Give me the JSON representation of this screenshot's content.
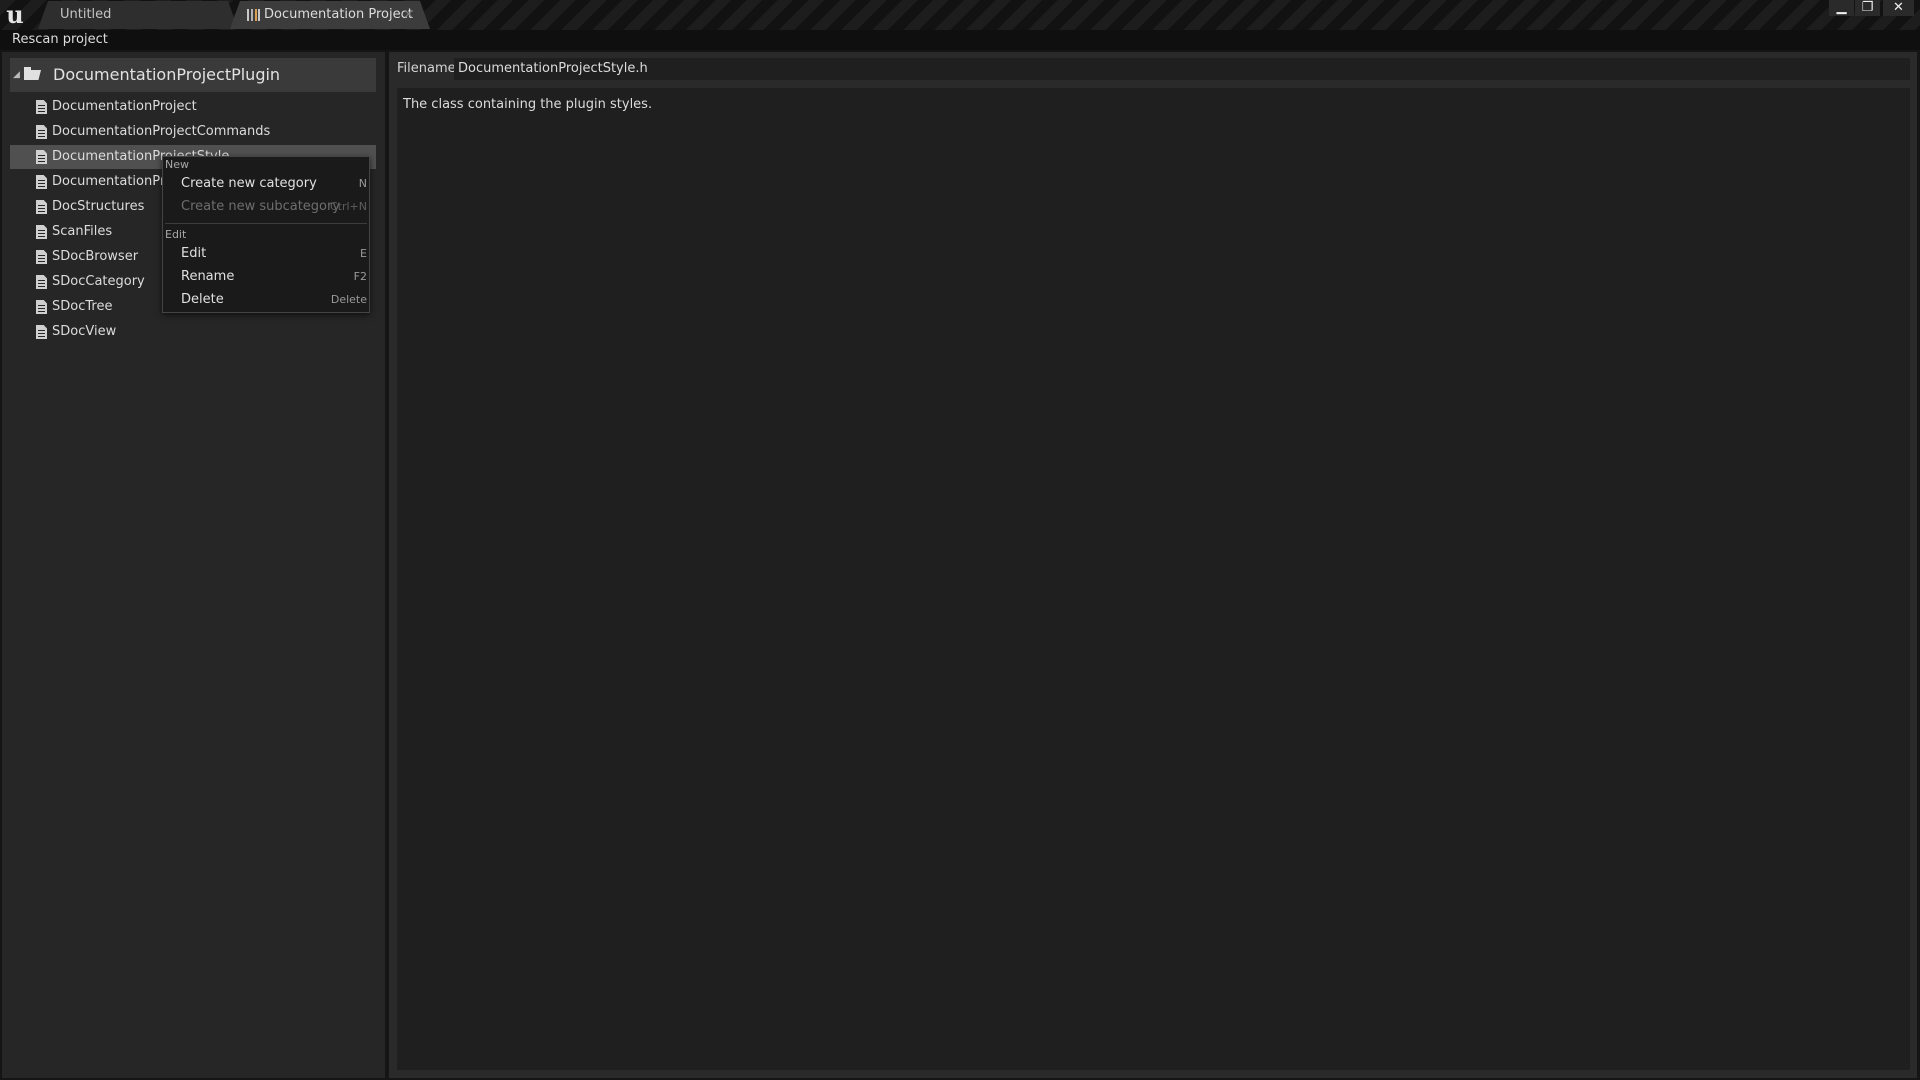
{
  "app": {
    "logo_icon": "unreal-engine-logo-icon"
  },
  "tabs": [
    {
      "label": "Untitled"
    },
    {
      "label": "Documentation Project",
      "close": "×"
    }
  ],
  "window_controls": {
    "minimize": "▁",
    "maximize": "❐",
    "close": "✕"
  },
  "toolbar": {
    "rescan_label": "Rescan project"
  },
  "tree": {
    "root": {
      "label": "DocumentationProjectPlugin",
      "expanded": true,
      "icon": "folder-open-icon"
    },
    "items": [
      {
        "label": "DocumentationProject"
      },
      {
        "label": "DocumentationProjectCommands"
      },
      {
        "label": "DocumentationProjectStyle",
        "selected": true
      },
      {
        "label": "DocumentationProj"
      },
      {
        "label": "DocStructures"
      },
      {
        "label": "ScanFiles"
      },
      {
        "label": "SDocBrowser"
      },
      {
        "label": "SDocCategory"
      },
      {
        "label": "SDocTree"
      },
      {
        "label": "SDocView"
      }
    ]
  },
  "details": {
    "filename_label": "Filename",
    "filename_value": "DocumentationProjectStyle.h",
    "description": "The class containing the plugin styles."
  },
  "context_menu": {
    "sections": [
      {
        "title": "New",
        "items": [
          {
            "label": "Create new category",
            "shortcut": "N",
            "enabled": true
          },
          {
            "label": "Create new subcategory",
            "shortcut": "Ctrl+N",
            "enabled": false
          }
        ]
      },
      {
        "title": "Edit",
        "items": [
          {
            "label": "Edit",
            "shortcut": "E",
            "enabled": true
          },
          {
            "label": "Rename",
            "shortcut": "F2",
            "enabled": true
          },
          {
            "label": "Delete",
            "shortcut": "Delete",
            "enabled": true
          }
        ]
      }
    ]
  },
  "colors": {
    "background": "#151515",
    "panel": "#262626",
    "selection": "#505050",
    "menu_background": "#1a1a1a"
  }
}
